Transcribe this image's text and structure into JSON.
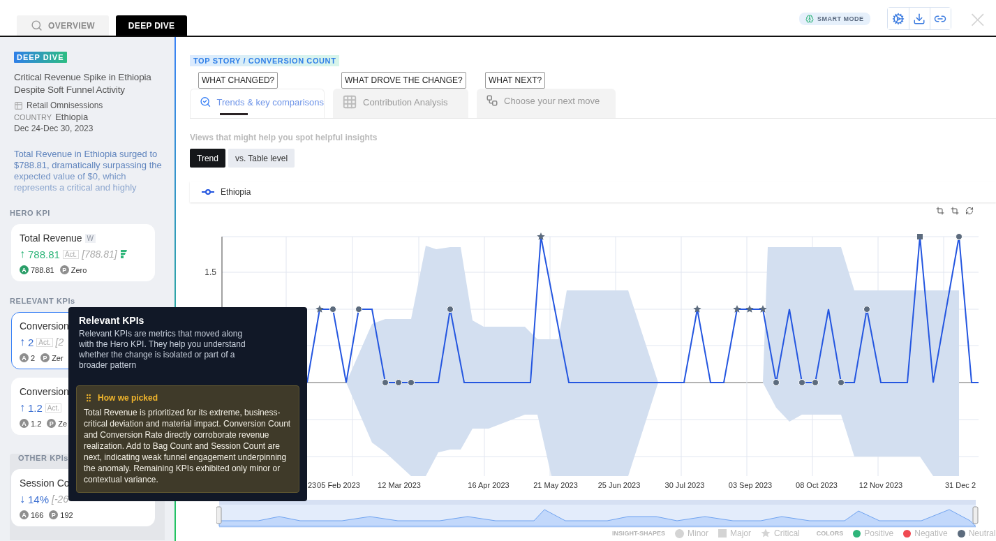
{
  "tabs": [
    {
      "label": "OVERVIEW",
      "selected": false,
      "kind": "overview"
    },
    {
      "label": "DEEP DIVE",
      "selected": true,
      "kind": "deep"
    }
  ],
  "header": {
    "smart_mode": "SMART MODE",
    "close": "×"
  },
  "sidebar": {
    "badge": "DEEP DIVE",
    "title": "Critical Revenue Spike in Ethiopia Despite Soft Funnel Activity",
    "dataset": "Retail Omnisessions",
    "country_label": "COUNTRY",
    "country": "Ethiopia",
    "date_range": "Dec 24-Dec 30, 2023",
    "summary": "Total Revenue in Ethiopia surged to $788.81, dramatically surpassing the expected value of $0, which represents a critical and highly",
    "sections": [
      {
        "kind": "plain",
        "title": "HERO KPI",
        "cards": [
          {
            "name": "Total Revenue",
            "tag": "W",
            "arrow": "↑",
            "positive": true,
            "value": "788.81",
            "unit_tag": "Act.",
            "expected": "[788.81]",
            "flag": true,
            "selected": false,
            "stats": [
              {
                "badge": "A",
                "value": "788.81"
              },
              {
                "badge": "P",
                "value": "Zero"
              }
            ]
          }
        ]
      },
      {
        "kind": "plain",
        "title": "RELEVANT KPIs",
        "cards": [
          {
            "name": "Conversion",
            "arrow": "↑",
            "positive": false,
            "value": "2",
            "unit_tag": "Act.",
            "expected": "[2",
            "flag": false,
            "selected": true,
            "stats": [
              {
                "badge": "A",
                "value": "2"
              },
              {
                "badge": "P",
                "value": "Zer"
              }
            ]
          },
          {
            "name": "Conversion",
            "arrow": "↑",
            "positive": false,
            "value": "1.2",
            "unit_tag": "Act.",
            "flag": false,
            "selected": false,
            "stats": [
              {
                "badge": "A",
                "value": "1.2"
              },
              {
                "badge": "P",
                "value": "Ze"
              }
            ]
          }
        ]
      },
      {
        "kind": "boxed",
        "title": "OTHER KPIs",
        "cards": [
          {
            "name": "Session Co",
            "arrow": "↓",
            "positive": false,
            "value": "14%",
            "expected": "[-26",
            "flag": false,
            "selected": false,
            "stats": [
              {
                "badge": "A",
                "value": "166"
              },
              {
                "badge": "P",
                "value": "192"
              }
            ]
          }
        ]
      }
    ]
  },
  "breadcrumb": "TOP STORY / CONVERSION COUNT",
  "story_tabs": [
    {
      "question": "WHAT CHANGED?",
      "label": "Trends & key comparisons",
      "kind": "trends",
      "selected": true
    },
    {
      "question": "WHAT DROVE THE CHANGE?",
      "label": "Contribution Analysis",
      "kind": "grid",
      "selected": false
    },
    {
      "question": "WHAT NEXT?",
      "label": "Choose your next move",
      "kind": "flow",
      "selected": false
    }
  ],
  "views_hint": "Views that might help you spot helpful insights",
  "view_toggles": [
    {
      "label": "Trend",
      "selected": true
    },
    {
      "label": "vs. Table level",
      "selected": false
    }
  ],
  "chart": {
    "series_legend": "Ethiopia",
    "y_tick": "1.5",
    "x_labels": [
      "23",
      "05 Feb 2023",
      "12 Mar 2023",
      "16 Apr 2023",
      "21 May 2023",
      "25 Jun 2023",
      "30 Jul 2023",
      "03 Sep 2023",
      "08 Oct 2023",
      "12 Nov 2023",
      "31 Dec 2"
    ]
  },
  "insight_legend": {
    "shapes_title": "INSIGHT-SHAPES",
    "shapes": [
      {
        "label": "Minor",
        "kind": "circle"
      },
      {
        "label": "Major",
        "kind": "square"
      },
      {
        "label": "Critical",
        "kind": "star"
      }
    ],
    "colors_title": "COLORS",
    "colors": [
      {
        "label": "Positive",
        "color": "#2fb57a"
      },
      {
        "label": "Negative",
        "color": "#f04a52"
      },
      {
        "label": "Neutral",
        "color": "#5c6b7d"
      }
    ]
  },
  "tooltip": {
    "title": "Relevant KPIs",
    "body": "Relevant KPIs are metrics that moved along with the Hero KPI. They help you understand whether the change is isolated or part of a broader pattern",
    "note_title": "How we picked",
    "note_body": "Total Revenue is prioritized for its extreme, business-critical deviation and material impact. Conversion Count and Conversion Rate directly corroborate revenue realization. Add to Bag Count and Session Count are next, indicating weak funnel engagement underpinning the anomaly. Remaining KPIs exhibited only minor or contextual variance."
  }
}
